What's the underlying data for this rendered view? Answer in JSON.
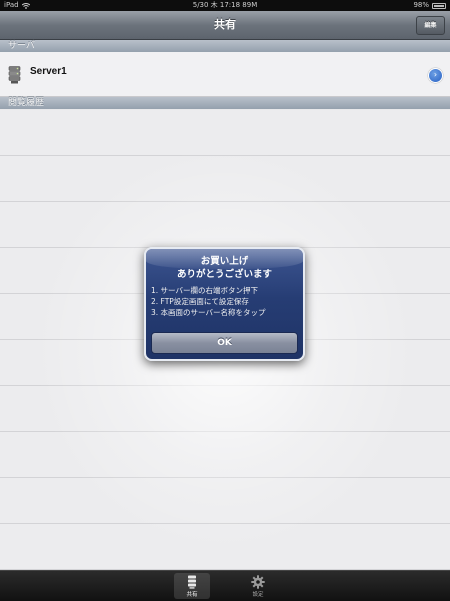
{
  "status_bar": {
    "device": "iPad",
    "datetime": "5/30 木 17:18 89M",
    "battery": "98%"
  },
  "nav": {
    "title": "共有",
    "edit_label": "編集"
  },
  "sections": {
    "server_header": "サーバ",
    "history_header": "閲覧履歴"
  },
  "servers": [
    {
      "label": "Server1",
      "icon": "server-icon"
    }
  ],
  "alert": {
    "title_line1": "お買い上げ",
    "title_line2": "ありがとうございます",
    "steps": [
      "1. サーバー欄の右端ボタン押下",
      "2. FTP設定画面にて設定保存",
      "3. 本画面のサーバー名称をタップ"
    ],
    "ok_label": "OK"
  },
  "tabs": [
    {
      "label": "共有",
      "icon": "share-icon",
      "active": true
    },
    {
      "label": "設定",
      "icon": "gear-icon",
      "active": false
    }
  ],
  "colors": {
    "alert_bg": "#263d74",
    "disclosure": "#2861c4",
    "nav_bar": "#6c737c"
  }
}
